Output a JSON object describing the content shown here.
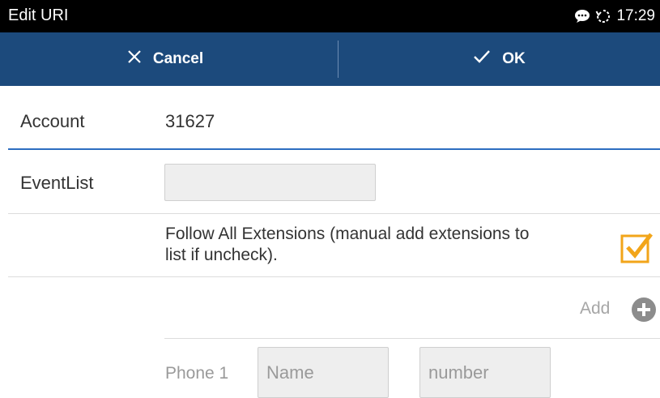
{
  "statusbar": {
    "title": "Edit URI",
    "time": "17:29",
    "icons": [
      "chat-bubble-icon",
      "sync-icon"
    ]
  },
  "actionbar": {
    "cancel_label": "Cancel",
    "ok_label": "OK"
  },
  "account": {
    "label": "Account",
    "value": "31627"
  },
  "eventlist": {
    "label": "EventList",
    "value": ""
  },
  "follow_all": {
    "text": "Follow All Extensions (manual add extensions to list if uncheck).",
    "checked": true,
    "accent_color": "#f2a51a"
  },
  "add": {
    "label": "Add"
  },
  "phone": {
    "label": "Phone 1",
    "name_placeholder": "Name",
    "number_placeholder": "number"
  },
  "colors": {
    "actionbar": "#1c4a7c",
    "statusbar": "#000000",
    "focus_line": "#2d6ec0"
  }
}
